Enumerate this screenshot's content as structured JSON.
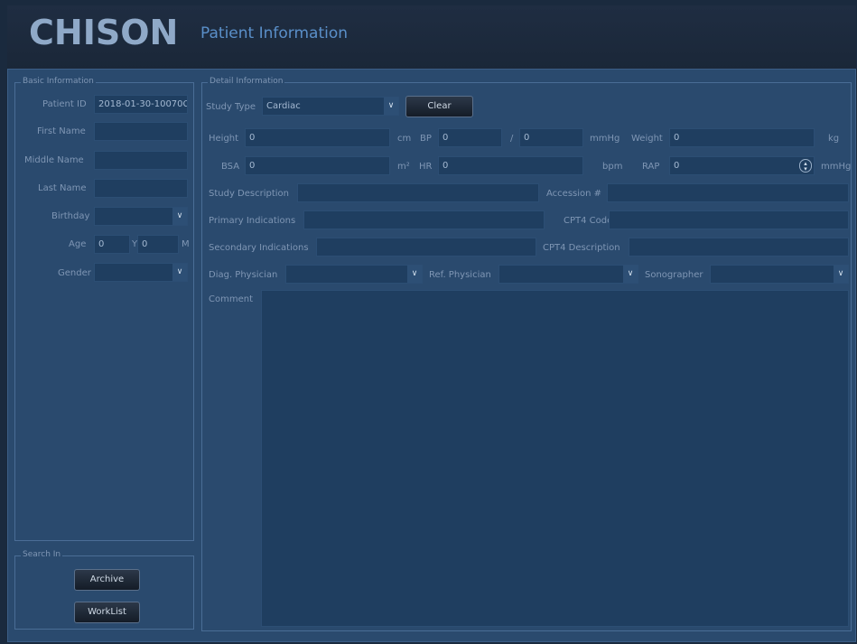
{
  "header": {
    "logo": "CHISON",
    "title": "Patient Information"
  },
  "basic": {
    "legend": "Basic Information",
    "patient_id_label": "Patient ID",
    "patient_id": "2018-01-30-10070C",
    "first_name_label": "First Name",
    "middle_name_label": "Middle Name",
    "last_name_label": "Last Name",
    "birthday_label": "Birthday",
    "age_label": "Age",
    "age_years": "0",
    "age_y_unit": "Y",
    "age_months": "0",
    "age_m_unit": "M",
    "gender_label": "Gender"
  },
  "search": {
    "legend": "Search In",
    "archive_label": "Archive",
    "worklist_label": "WorkList"
  },
  "detail": {
    "legend": "Detail Information",
    "study_type_label": "Study Type",
    "study_type": "Cardiac",
    "clear_label": "Clear",
    "height_label": "Height",
    "height": "0",
    "height_unit": "cm",
    "bp_label": "BP",
    "bp_sys": "0",
    "bp_sep": "/",
    "bp_dia": "0",
    "bp_unit": "mmHg",
    "weight_label": "Weight",
    "weight": "0",
    "weight_unit": "kg",
    "bsa_label": "BSA",
    "bsa": "0",
    "bsa_unit": "m²",
    "hr_label": "HR",
    "hr": "0",
    "hr_unit": "bpm",
    "rap_label": "RAP",
    "rap": "0",
    "rap_unit": "mmHg",
    "study_desc_label": "Study Description",
    "accession_label": "Accession #",
    "primary_label": "Primary Indications",
    "cpt4_code_label": "CPT4 Code",
    "secondary_label": "Secondary Indications",
    "cpt4_desc_label": "CPT4 Description",
    "diag_label": "Diag. Physician",
    "ref_label": "Ref. Physician",
    "sono_label": "Sonographer",
    "comment_label": "Comment"
  },
  "icons": {
    "dropdown": "chevron-down-icon",
    "spinner": "spinner-icon"
  },
  "colors": {
    "background": "#2a4a6e",
    "field": "#1f3e60",
    "label": "#7f96b4",
    "title": "#5a8fc9"
  }
}
